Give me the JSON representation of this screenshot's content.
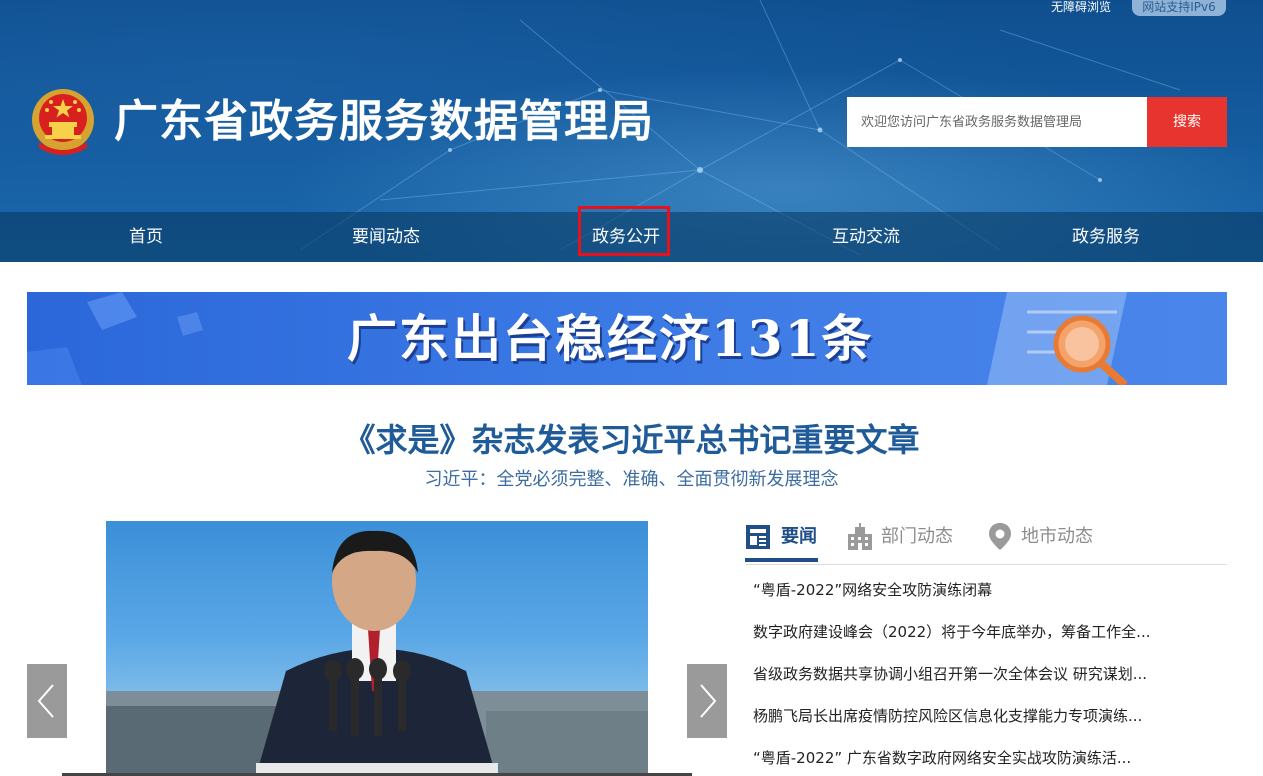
{
  "topbar": {
    "accessibility_label": "无障碍浏览",
    "ipv6_label": "网站支持IPv6"
  },
  "header": {
    "site_title": "广东省政务服务数据管理局",
    "search_placeholder": "欢迎您访问广东省政务服务数据管理局",
    "search_button": "搜索"
  },
  "nav": {
    "items": [
      {
        "label": "首页"
      },
      {
        "label": "要闻动态"
      },
      {
        "label": "政务公开"
      },
      {
        "label": "互动交流"
      },
      {
        "label": "政务服务"
      }
    ],
    "highlighted": "政务公开"
  },
  "banner": {
    "text": "广东出台稳经济131条"
  },
  "headline": {
    "title": "《求是》杂志发表习近平总书记重要文章",
    "subtitle": "习近平：全党必须完整、准确、全面贯彻新发展理念"
  },
  "news": {
    "tabs": [
      {
        "label": "要闻",
        "icon": "newspaper-icon",
        "active": true
      },
      {
        "label": "部门动态",
        "icon": "building-icon",
        "active": false
      },
      {
        "label": "地市动态",
        "icon": "location-pin-icon",
        "active": false
      }
    ],
    "items": [
      "“粤盾-2022”网络安全攻防演练闭幕",
      "数字政府建设峰会（2022）将于今年底举办，筹备工作全...",
      "省级政务数据共享协调小组召开第一次全体会议 研究谋划...",
      "杨鹏飞局长出席疫情防控风险区信息化支撑能力专项演练...",
      "“粤盾-2022” 广东省数字政府网络安全实战攻防演练活..."
    ]
  },
  "colors": {
    "header_blue": "#145c9f",
    "search_red": "#e8342f",
    "highlight_red": "#e5121c",
    "headline_blue": "#1f5b98",
    "tab_active": "#1f4f86"
  }
}
